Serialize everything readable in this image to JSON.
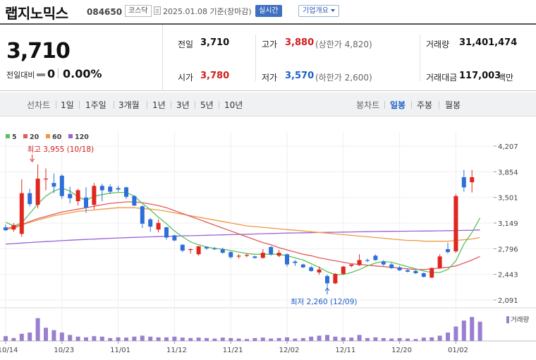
{
  "stock": {
    "name": "랩지노믹스",
    "code": "084650",
    "market": "코스닥",
    "date": "2025.01.08 기준(장마감)",
    "realtime": "실시간",
    "corp_info": "기업개요"
  },
  "quote": {
    "price": "3,710",
    "change_label": "전일대비",
    "change": "0",
    "change_pct": "0.00%",
    "prev_label": "전일",
    "prev": "3,710",
    "high_label": "고가",
    "high": "3,880",
    "upper_limit": "(상한가 4,820)",
    "volume_label": "거래량",
    "volume": "31,401,474",
    "open_label": "시가",
    "open": "3,780",
    "low_label": "저가",
    "low": "3,570",
    "lower_limit": "(하한가 2,600)",
    "amount_label": "거래대금",
    "amount": "117,003",
    "amount_unit": "백만"
  },
  "range_bar": {
    "line_label": "선차트",
    "periods": [
      "1일",
      "1주일",
      "3개월",
      "1년",
      "3년",
      "5년",
      "10년"
    ],
    "candle_label": "봉차트",
    "candle_types": [
      "일봉",
      "주봉",
      "월봉"
    ],
    "candle_selected": "일봉"
  },
  "colors": {
    "up": "#e0261e",
    "down": "#2d6fd8",
    "ma5": "#5cc05c",
    "ma20": "#e15b5b",
    "ma60": "#ee9944",
    "ma120": "#9a62d6"
  },
  "chart_data": {
    "type": "candlestick",
    "legend": [
      {
        "name": "5",
        "color": "#5cc05c"
      },
      {
        "name": "20",
        "color": "#e15b5b"
      },
      {
        "name": "60",
        "color": "#ee9944"
      },
      {
        "name": "120",
        "color": "#9a62d6"
      }
    ],
    "y_ticks": [
      "4,207",
      "3,854",
      "3,501",
      "3,149",
      "2,796",
      "2,443",
      "2,091"
    ],
    "y_range": [
      2091,
      4207
    ],
    "x_ticks": [
      "10/14",
      "10/23",
      "11/01",
      "11/12",
      "11/21",
      "12/02",
      "12/11",
      "12/20",
      "01/02"
    ],
    "x_tick_index": [
      0,
      7,
      14,
      21,
      28,
      35,
      42,
      49,
      56
    ],
    "annotations": {
      "high": {
        "text": "최고 3,955 (10/18)",
        "index": 4,
        "value": 3955
      },
      "low": {
        "text": "최저 2,260 (12/09)",
        "index": 40,
        "value": 2260
      }
    },
    "volume_label": "거래량",
    "candles": [
      {
        "o": 3090,
        "h": 3130,
        "l": 3040,
        "c": 3050
      },
      {
        "o": 3060,
        "h": 3150,
        "l": 3030,
        "c": 3120
      },
      {
        "o": 3000,
        "h": 3750,
        "l": 2960,
        "c": 3560
      },
      {
        "o": 3560,
        "h": 3620,
        "l": 3380,
        "c": 3410
      },
      {
        "o": 3400,
        "h": 3955,
        "l": 3350,
        "c": 3760
      },
      {
        "o": 3750,
        "h": 3900,
        "l": 3600,
        "c": 3760
      },
      {
        "o": 3700,
        "h": 3830,
        "l": 3560,
        "c": 3650
      },
      {
        "o": 3800,
        "h": 3820,
        "l": 3480,
        "c": 3520
      },
      {
        "o": 3550,
        "h": 3650,
        "l": 3420,
        "c": 3490
      },
      {
        "o": 3450,
        "h": 3620,
        "l": 3390,
        "c": 3600
      },
      {
        "o": 3500,
        "h": 3640,
        "l": 3290,
        "c": 3360
      },
      {
        "o": 3400,
        "h": 3700,
        "l": 3340,
        "c": 3660
      },
      {
        "o": 3660,
        "h": 3690,
        "l": 3450,
        "c": 3600
      },
      {
        "o": 3650,
        "h": 3680,
        "l": 3550,
        "c": 3580
      },
      {
        "o": 3630,
        "h": 3660,
        "l": 3580,
        "c": 3610
      },
      {
        "o": 3640,
        "h": 3650,
        "l": 3480,
        "c": 3510
      },
      {
        "o": 3520,
        "h": 3530,
        "l": 3380,
        "c": 3390
      },
      {
        "o": 3380,
        "h": 3390,
        "l": 3080,
        "c": 3140
      },
      {
        "o": 3200,
        "h": 3220,
        "l": 3030,
        "c": 3100
      },
      {
        "o": 3060,
        "h": 3200,
        "l": 3020,
        "c": 3150
      },
      {
        "o": 3090,
        "h": 3100,
        "l": 2920,
        "c": 2950
      },
      {
        "o": 2980,
        "h": 2990,
        "l": 2900,
        "c": 2910
      },
      {
        "o": 2850,
        "h": 2860,
        "l": 2750,
        "c": 2770
      },
      {
        "o": 2780,
        "h": 2800,
        "l": 2730,
        "c": 2790
      },
      {
        "o": 2720,
        "h": 2830,
        "l": 2700,
        "c": 2830
      },
      {
        "o": 2820,
        "h": 2830,
        "l": 2780,
        "c": 2800
      },
      {
        "o": 2800,
        "h": 2820,
        "l": 2780,
        "c": 2790
      },
      {
        "o": 2790,
        "h": 2810,
        "l": 2730,
        "c": 2740
      },
      {
        "o": 2750,
        "h": 2760,
        "l": 2660,
        "c": 2680
      },
      {
        "o": 2690,
        "h": 2720,
        "l": 2660,
        "c": 2700
      },
      {
        "o": 2700,
        "h": 2730,
        "l": 2680,
        "c": 2710
      },
      {
        "o": 2690,
        "h": 2700,
        "l": 2660,
        "c": 2670
      },
      {
        "o": 2670,
        "h": 2790,
        "l": 2660,
        "c": 2740
      },
      {
        "o": 2820,
        "h": 2830,
        "l": 2700,
        "c": 2720
      },
      {
        "o": 2700,
        "h": 2780,
        "l": 2680,
        "c": 2740
      },
      {
        "o": 2720,
        "h": 2730,
        "l": 2550,
        "c": 2580
      },
      {
        "o": 2620,
        "h": 2640,
        "l": 2560,
        "c": 2600
      },
      {
        "o": 2580,
        "h": 2590,
        "l": 2530,
        "c": 2540
      },
      {
        "o": 2540,
        "h": 2560,
        "l": 2480,
        "c": 2490
      },
      {
        "o": 2470,
        "h": 2550,
        "l": 2440,
        "c": 2510
      },
      {
        "o": 2420,
        "h": 2440,
        "l": 2260,
        "c": 2320
      },
      {
        "o": 2320,
        "h": 2460,
        "l": 2310,
        "c": 2450
      },
      {
        "o": 2450,
        "h": 2560,
        "l": 2440,
        "c": 2550
      },
      {
        "o": 2560,
        "h": 2580,
        "l": 2540,
        "c": 2580
      },
      {
        "o": 2570,
        "h": 2720,
        "l": 2560,
        "c": 2640
      },
      {
        "o": 2640,
        "h": 2660,
        "l": 2610,
        "c": 2630
      },
      {
        "o": 2700,
        "h": 2720,
        "l": 2630,
        "c": 2640
      },
      {
        "o": 2620,
        "h": 2640,
        "l": 2560,
        "c": 2580
      },
      {
        "o": 2580,
        "h": 2600,
        "l": 2520,
        "c": 2530
      },
      {
        "o": 2540,
        "h": 2560,
        "l": 2490,
        "c": 2500
      },
      {
        "o": 2500,
        "h": 2520,
        "l": 2470,
        "c": 2480
      },
      {
        "o": 2490,
        "h": 2500,
        "l": 2450,
        "c": 2460
      },
      {
        "o": 2460,
        "h": 2470,
        "l": 2400,
        "c": 2410
      },
      {
        "o": 2400,
        "h": 2540,
        "l": 2390,
        "c": 2530
      },
      {
        "o": 2530,
        "h": 2720,
        "l": 2520,
        "c": 2690
      },
      {
        "o": 2790,
        "h": 2880,
        "l": 2730,
        "c": 2750
      },
      {
        "o": 2760,
        "h": 3550,
        "l": 2740,
        "c": 3520
      },
      {
        "o": 3780,
        "h": 3880,
        "l": 3580,
        "c": 3640
      },
      {
        "o": 3710,
        "h": 3880,
        "l": 3570,
        "c": 3780
      }
    ],
    "ma5": [
      3160,
      3110,
      3150,
      3280,
      3410,
      3520,
      3590,
      3630,
      3590,
      3510,
      3460,
      3520,
      3540,
      3560,
      3570,
      3570,
      3520,
      3420,
      3330,
      3230,
      3140,
      3040,
      2960,
      2890,
      2850,
      2820,
      2800,
      2790,
      2770,
      2750,
      2730,
      2720,
      2720,
      2720,
      2720,
      2700,
      2670,
      2640,
      2590,
      2540,
      2480,
      2440,
      2440,
      2470,
      2510,
      2560,
      2600,
      2620,
      2610,
      2580,
      2550,
      2520,
      2490,
      2470,
      2470,
      2510,
      2630,
      2860,
      3020,
      3220
    ],
    "ma20": [
      3080,
      3090,
      3130,
      3170,
      3210,
      3240,
      3270,
      3300,
      3320,
      3340,
      3360,
      3380,
      3400,
      3420,
      3430,
      3440,
      3440,
      3430,
      3410,
      3390,
      3360,
      3320,
      3280,
      3240,
      3200,
      3160,
      3120,
      3080,
      3040,
      3000,
      2960,
      2920,
      2880,
      2850,
      2810,
      2780,
      2750,
      2720,
      2700,
      2670,
      2650,
      2630,
      2610,
      2590,
      2580,
      2570,
      2560,
      2550,
      2540,
      2530,
      2520,
      2510,
      2510,
      2520,
      2530,
      2540,
      2560,
      2600,
      2640,
      2690
    ],
    "ma60": [
      3060,
      3080,
      3120,
      3160,
      3190,
      3220,
      3250,
      3270,
      3290,
      3310,
      3320,
      3330,
      3340,
      3350,
      3360,
      3360,
      3360,
      3350,
      3340,
      3330,
      3310,
      3290,
      3270,
      3250,
      3230,
      3210,
      3190,
      3170,
      3150,
      3130,
      3110,
      3100,
      3090,
      3080,
      3070,
      3060,
      3050,
      3040,
      3030,
      3020,
      3010,
      3000,
      2990,
      2980,
      2970,
      2960,
      2950,
      2940,
      2930,
      2920,
      2910,
      2910,
      2900,
      2900,
      2900,
      2900,
      2910,
      2920,
      2930,
      2950
    ],
    "ma120": [
      2860,
      2867,
      2874,
      2881,
      2888,
      2895,
      2901,
      2907,
      2913,
      2919,
      2924,
      2929,
      2934,
      2939,
      2944,
      2948,
      2952,
      2956,
      2960,
      2963,
      2966,
      2969,
      2972,
      2975,
      2978,
      2981,
      2984,
      2987,
      2990,
      2993,
      2996,
      2999,
      3002,
      3005,
      3008,
      3011,
      3013,
      3015,
      3017,
      3019,
      3021,
      3023,
      3025,
      3027,
      3029,
      3031,
      3033,
      3034,
      3035,
      3036,
      3037,
      3038,
      3039,
      3040,
      3042,
      3044,
      3046,
      3048,
      3050,
      3055
    ],
    "volume": [
      20,
      12,
      30,
      35,
      95,
      55,
      45,
      35,
      25,
      18,
      15,
      20,
      18,
      12,
      15,
      14,
      18,
      22,
      18,
      15,
      15,
      18,
      14,
      12,
      14,
      12,
      10,
      14,
      12,
      10,
      8,
      12,
      14,
      10,
      12,
      15,
      10,
      12,
      18,
      22,
      25,
      18,
      15,
      14,
      25,
      12,
      15,
      12,
      10,
      12,
      10,
      8,
      14,
      15,
      22,
      35,
      60,
      85,
      100,
      80
    ]
  }
}
